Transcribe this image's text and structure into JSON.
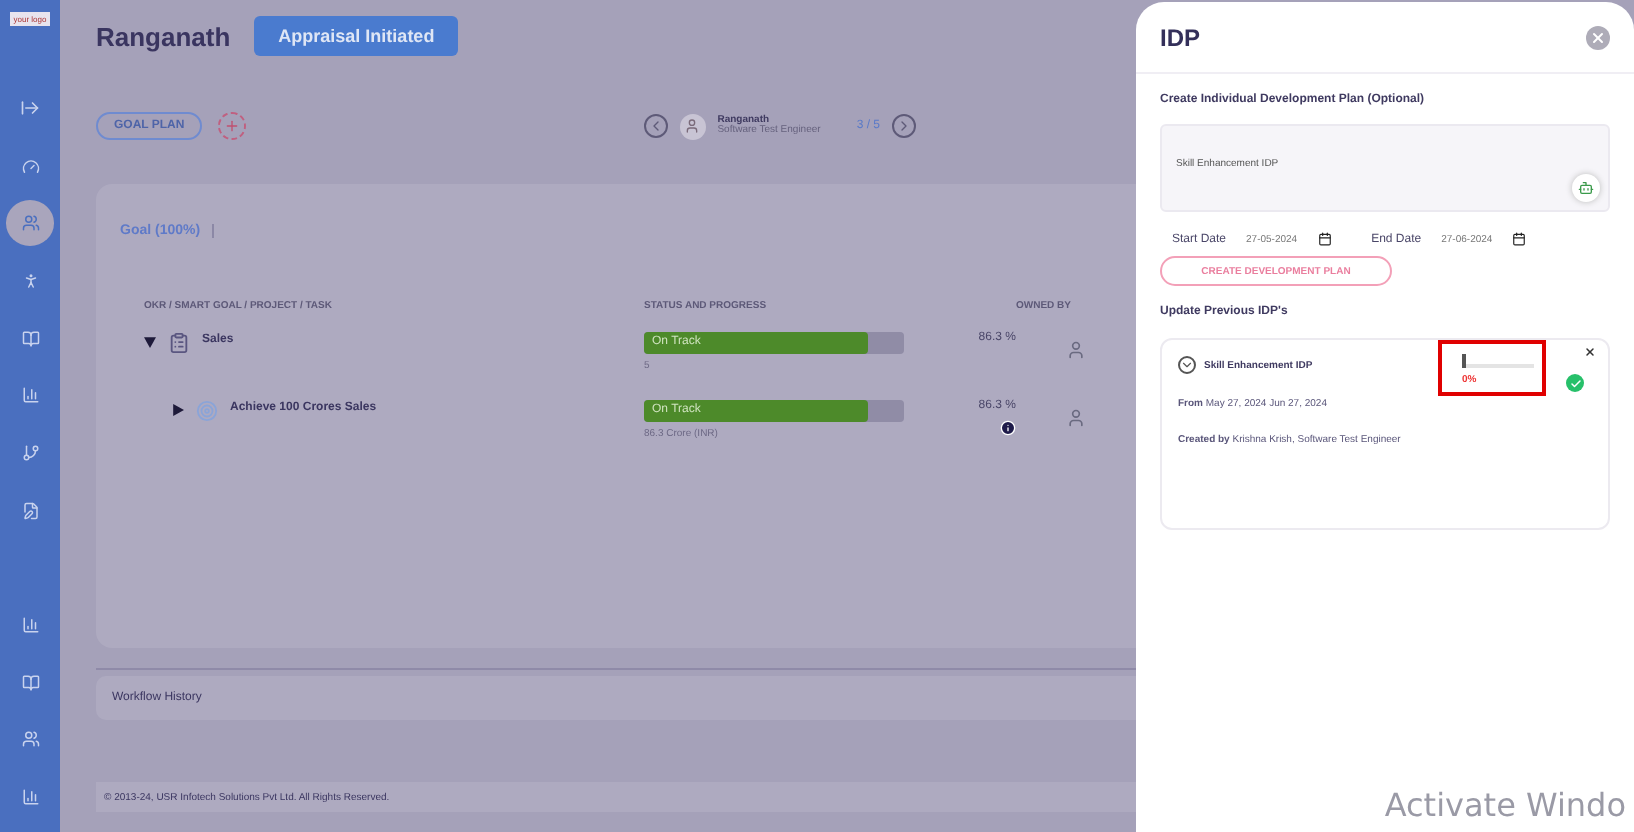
{
  "logo": "your logo",
  "sidebar": {
    "items": [
      {
        "selected": false
      },
      {
        "selected": true
      },
      {
        "selected": false
      },
      {
        "selected": false
      },
      {
        "selected": false
      },
      {
        "selected": false
      },
      {
        "selected": false
      },
      {
        "selected": false
      },
      {
        "selected": false
      },
      {
        "selected": false
      },
      {
        "selected": false
      }
    ]
  },
  "header": {
    "name": "Ranganath",
    "status": "Appraisal Initiated"
  },
  "goal_plan_button": "GOAL PLAN",
  "employee_nav": {
    "name": "Ranganath",
    "role": "Software Test Engineer",
    "position": "3 / 5"
  },
  "goal_tab": "Goal (100%)",
  "table": {
    "columns": [
      "OKR / SMART GOAL / PROJECT / TASK",
      "STATUS AND PROGRESS",
      "OWNED BY"
    ],
    "rows": [
      {
        "title": "Sales",
        "expanded": true,
        "status": "On Track",
        "level": 0.863,
        "sub": "5",
        "percent": "86.3",
        "unit": "%",
        "info": false,
        "children": [
          {
            "title": "Achieve 100 Crores Sales",
            "expanded": false,
            "status": "On Track",
            "level": 0.863,
            "sub": "86.3 Crore (INR)",
            "percent": "86.3",
            "unit": "%",
            "info": true
          }
        ]
      }
    ]
  },
  "workflow_history": "Workflow History",
  "footer": "© 2013-24, USR Infotech Solutions Pvt Ltd. All Rights Reserved.",
  "idp": {
    "title": "IDP",
    "section": "Create Individual Development Plan (Optional)",
    "plan_value": "Skill Enhancement IDP",
    "start_label": "Start Date",
    "start_value": "27-05-2024",
    "end_label": "End Date",
    "end_value": "27-06-2024",
    "create_button": "CREATE DEVELOPMENT PLAN",
    "previous_label": "Update Previous IDP's",
    "previous": [
      {
        "title": "Skill Enhancement IDP",
        "level": 0,
        "reading": "0%",
        "highlighted": true,
        "completed": true,
        "dates": "**From** May 27, 2024 Jun 27, 2024",
        "created": "**Created by** Krishna Krish, Software Test Engineer"
      }
    ]
  },
  "os_notice": "Activate Windo"
}
